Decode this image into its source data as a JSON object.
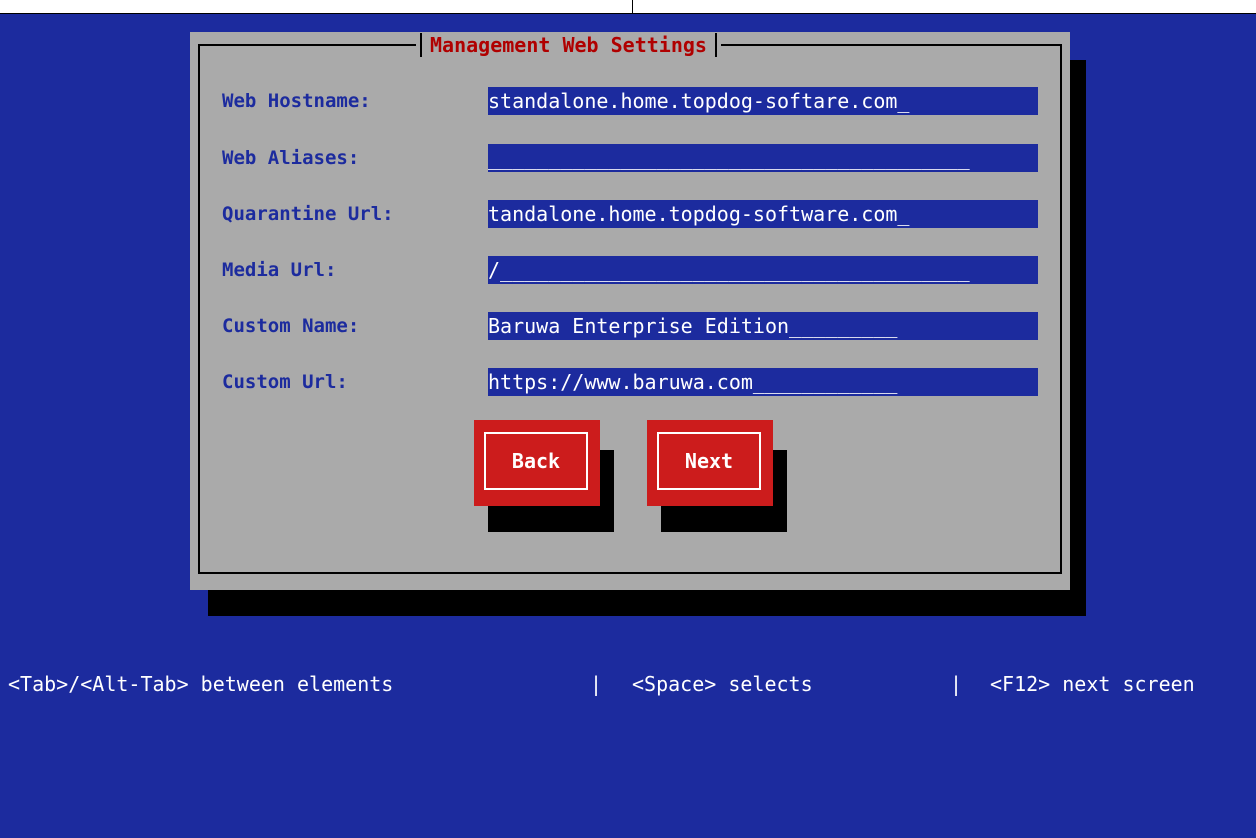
{
  "dialog": {
    "title": "Management Web Settings"
  },
  "fields": [
    {
      "label": "Web Hostname:",
      "value": "standalone.home.topdog-softare.com_"
    },
    {
      "label": "Web Aliases:",
      "value": "________________________________________"
    },
    {
      "label": "Quarantine Url:",
      "value": "tandalone.home.topdog-software.com_"
    },
    {
      "label": "Media Url:",
      "value": "/_______________________________________"
    },
    {
      "label": "Custom Name:",
      "value": "Baruwa Enterprise Edition_________"
    },
    {
      "label": "Custom Url:",
      "value": "https://www.baruwa.com____________"
    }
  ],
  "buttons": {
    "back": "Back",
    "next": "Next"
  },
  "help": {
    "tab": "<Tab>/<Alt-Tab> between elements",
    "sep1": "|",
    "space": "<Space> selects",
    "sep2": "|",
    "f12": "<F12> next screen"
  },
  "colors": {
    "background": "#1c2b9e",
    "dialog": "#aaaaaa",
    "title": "#b00000",
    "button": "#cc1c1c",
    "field": "#1c2b9e"
  }
}
